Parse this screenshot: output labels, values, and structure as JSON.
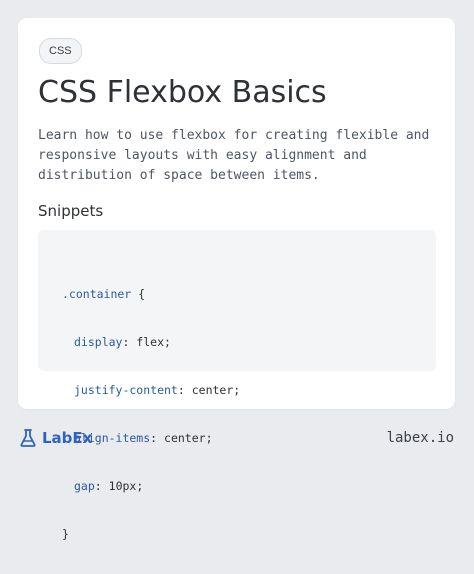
{
  "card": {
    "tag": "CSS",
    "title": "CSS Flexbox Basics",
    "description": "Learn how to use flexbox for creating flexible and responsive layouts with easy alignment and distribution of space between items.",
    "snippets_heading": "Snippets"
  },
  "code": {
    "selector": ".container",
    "open_brace": " {",
    "close_brace": "}",
    "declarations": [
      {
        "property": "display",
        "value": "flex"
      },
      {
        "property": "justify-content",
        "value": "center"
      },
      {
        "property": "align-items",
        "value": "center"
      },
      {
        "property": "gap",
        "value": "10px"
      }
    ]
  },
  "footer": {
    "brand": "LabEx",
    "url": "labex.io"
  },
  "colors": {
    "background": "#e9ebee",
    "card": "#ffffff",
    "code_bg": "#f4f5f7",
    "brand": "#2d64c0",
    "code_keyword": "#2b5a9e"
  },
  "icons": {
    "logo": "flask-icon"
  }
}
